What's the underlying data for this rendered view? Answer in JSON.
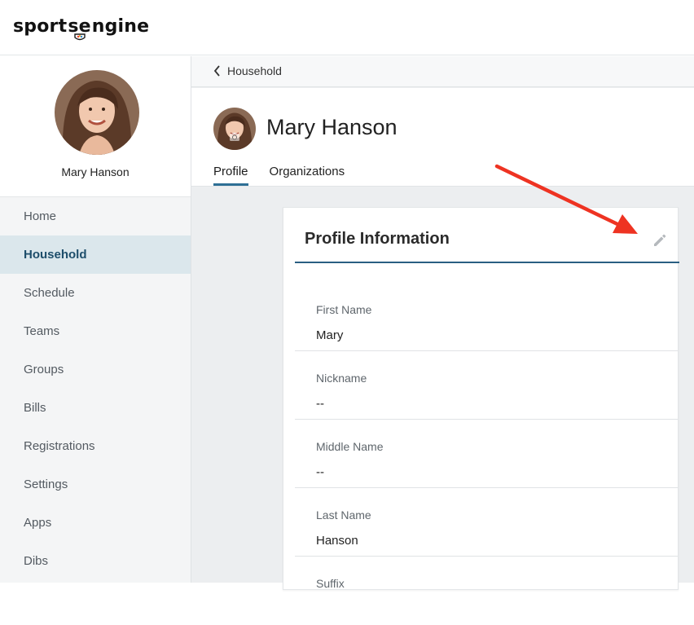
{
  "app": {
    "brand_left": "sport",
    "brand_mid": "se",
    "brand_right": "ngine"
  },
  "sidebar": {
    "user_name": "Mary Hanson",
    "items": [
      {
        "label": "Home",
        "active": false
      },
      {
        "label": "Household",
        "active": true
      },
      {
        "label": "Schedule",
        "active": false
      },
      {
        "label": "Teams",
        "active": false
      },
      {
        "label": "Groups",
        "active": false
      },
      {
        "label": "Bills",
        "active": false
      },
      {
        "label": "Registrations",
        "active": false
      },
      {
        "label": "Settings",
        "active": false
      },
      {
        "label": "Apps",
        "active": false
      },
      {
        "label": "Dibs",
        "active": false
      }
    ]
  },
  "breadcrumb": {
    "back_label": "Household"
  },
  "header": {
    "title": "Mary Hanson",
    "tabs": [
      {
        "label": "Profile",
        "active": true
      },
      {
        "label": "Organizations",
        "active": false
      }
    ]
  },
  "card": {
    "title": "Profile Information",
    "fields": [
      {
        "label": "First Name",
        "value": "Mary"
      },
      {
        "label": "Nickname",
        "value": "--"
      },
      {
        "label": "Middle Name",
        "value": "--"
      },
      {
        "label": "Last Name",
        "value": "Hanson"
      },
      {
        "label": "Suffix",
        "value": ""
      }
    ]
  },
  "colors": {
    "accent": "#2e6f95",
    "nav_active_bg": "#dbe7ec",
    "arrow": "#ee3322"
  }
}
